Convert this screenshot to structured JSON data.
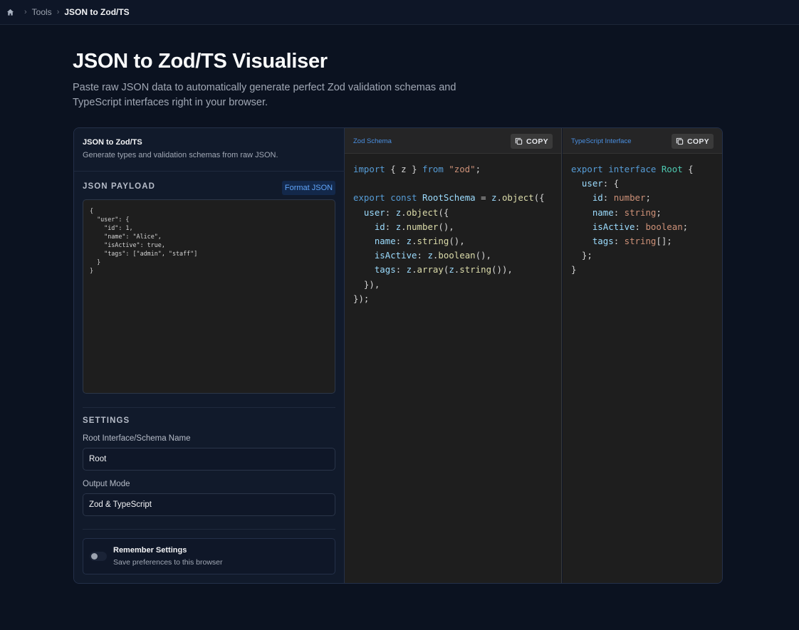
{
  "breadcrumb": {
    "items": [
      "Tools",
      "JSON to Zod/TS"
    ]
  },
  "page": {
    "title": "JSON to Zod/TS Visualiser",
    "subtitle": "Paste raw JSON data to automatically generate perfect Zod validation schemas and TypeScript interfaces right in your browser."
  },
  "tool": {
    "name": "JSON to Zod/TS",
    "description": "Generate types and validation schemas from raw JSON."
  },
  "payload": {
    "label": "JSON PAYLOAD",
    "format_button": "Format JSON",
    "value": "{\n  \"user\": {\n    \"id\": 1,\n    \"name\": \"Alice\",\n    \"isActive\": true,\n    \"tags\": [\"admin\", \"staff\"]\n  }\n}"
  },
  "settings": {
    "label": "SETTINGS",
    "root_name_label": "Root Interface/Schema Name",
    "root_name_value": "Root",
    "output_mode_label": "Output Mode",
    "output_mode_value": "Zod & TypeScript",
    "remember_title": "Remember Settings",
    "remember_desc": "Save preferences to this browser",
    "remember_enabled": false
  },
  "zod_pane": {
    "title": "Zod Schema",
    "copy_label": "COPY"
  },
  "ts_pane": {
    "title": "TypeScript Interface",
    "copy_label": "COPY"
  },
  "zod_code": [
    [
      [
        "kw",
        "import"
      ],
      [
        "p",
        " { z } "
      ],
      [
        "kw",
        "from"
      ],
      [
        "p",
        " "
      ],
      [
        "str",
        "\"zod\""
      ],
      [
        "p",
        ";"
      ]
    ],
    [],
    [
      [
        "kw",
        "export"
      ],
      [
        "p",
        " "
      ],
      [
        "kw",
        "const"
      ],
      [
        "p",
        " "
      ],
      [
        "pr",
        "RootSchema"
      ],
      [
        "p",
        " = "
      ],
      [
        "pr",
        "z"
      ],
      [
        "p",
        "."
      ],
      [
        "fn",
        "object"
      ],
      [
        "p",
        "({"
      ]
    ],
    [
      [
        "p",
        "  "
      ],
      [
        "pr",
        "user"
      ],
      [
        "p",
        ": "
      ],
      [
        "pr",
        "z"
      ],
      [
        "p",
        "."
      ],
      [
        "fn",
        "object"
      ],
      [
        "p",
        "({"
      ]
    ],
    [
      [
        "p",
        "    "
      ],
      [
        "pr",
        "id"
      ],
      [
        "p",
        ": "
      ],
      [
        "pr",
        "z"
      ],
      [
        "p",
        "."
      ],
      [
        "fn",
        "number"
      ],
      [
        "p",
        "(),"
      ]
    ],
    [
      [
        "p",
        "    "
      ],
      [
        "pr",
        "name"
      ],
      [
        "p",
        ": "
      ],
      [
        "pr",
        "z"
      ],
      [
        "p",
        "."
      ],
      [
        "fn",
        "string"
      ],
      [
        "p",
        "(),"
      ]
    ],
    [
      [
        "p",
        "    "
      ],
      [
        "pr",
        "isActive"
      ],
      [
        "p",
        ": "
      ],
      [
        "pr",
        "z"
      ],
      [
        "p",
        "."
      ],
      [
        "fn",
        "boolean"
      ],
      [
        "p",
        "(),"
      ]
    ],
    [
      [
        "p",
        "    "
      ],
      [
        "pr",
        "tags"
      ],
      [
        "p",
        ": "
      ],
      [
        "pr",
        "z"
      ],
      [
        "p",
        "."
      ],
      [
        "fn",
        "array"
      ],
      [
        "p",
        "("
      ],
      [
        "pr",
        "z"
      ],
      [
        "p",
        "."
      ],
      [
        "fn",
        "string"
      ],
      [
        "p",
        "()),"
      ]
    ],
    [
      [
        "p",
        "  }),"
      ]
    ],
    [
      [
        "p",
        "});"
      ]
    ]
  ],
  "ts_code": [
    [
      [
        "kw",
        "export"
      ],
      [
        "p",
        " "
      ],
      [
        "kw",
        "interface"
      ],
      [
        "p",
        " "
      ],
      [
        "ty",
        "Root"
      ],
      [
        "p",
        " {"
      ]
    ],
    [
      [
        "p",
        "  "
      ],
      [
        "pr",
        "user"
      ],
      [
        "p",
        ": {"
      ]
    ],
    [
      [
        "p",
        "    "
      ],
      [
        "pr",
        "id"
      ],
      [
        "p",
        ": "
      ],
      [
        "str",
        "number"
      ],
      [
        "p",
        ";"
      ]
    ],
    [
      [
        "p",
        "    "
      ],
      [
        "pr",
        "name"
      ],
      [
        "p",
        ": "
      ],
      [
        "str",
        "string"
      ],
      [
        "p",
        ";"
      ]
    ],
    [
      [
        "p",
        "    "
      ],
      [
        "pr",
        "isActive"
      ],
      [
        "p",
        ": "
      ],
      [
        "str",
        "boolean"
      ],
      [
        "p",
        ";"
      ]
    ],
    [
      [
        "p",
        "    "
      ],
      [
        "pr",
        "tags"
      ],
      [
        "p",
        ": "
      ],
      [
        "str",
        "string"
      ],
      [
        "p",
        "[];"
      ]
    ],
    [
      [
        "p",
        "  };"
      ]
    ],
    [
      [
        "p",
        "}"
      ]
    ]
  ],
  "colors": {
    "background": "#0b1220",
    "accent": "#60a5fa",
    "editor_bg": "#1e1e1e",
    "keyword": "#569cd6",
    "string": "#ce9178",
    "type": "#4ec9b0",
    "function": "#dcdcaa",
    "property": "#9cdcfe"
  },
  "icons": {
    "home": "home-icon",
    "copy": "copy-icon",
    "chevron": "chevron-right-icon"
  }
}
